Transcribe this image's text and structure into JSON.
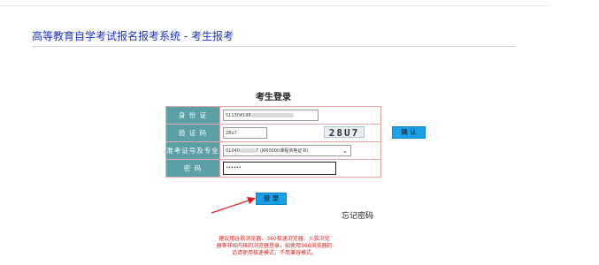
{
  "header": {
    "system_title": "高等教育自学考试报名报考系统 - 考生报考"
  },
  "login": {
    "heading": "考生登录",
    "id_label": "身 份 证",
    "id_value": "511304198",
    "captcha_label": "验 证 码",
    "captcha_input_value": "28u7",
    "captcha_image_text": "28U7",
    "confirm_button": "确 认",
    "major_label": "准考证号及专业",
    "major_select_value": "01040",
    "major_select_suffix": "7 (J660000课程资格证书)",
    "password_label": "密 码",
    "password_value": "••••••",
    "login_button": "登 录",
    "forgot_password": "忘记密码"
  },
  "notice": {
    "lines": [
      "建议用谷歌浏览器、360极速浏览器、火狐浏览",
      "器等非IE内核的浏览器登录，如使用360浏览器的",
      "话请使用极速模式，不用兼容模式。"
    ]
  },
  "colors": {
    "title_blue": "#1a2fd6",
    "label_teal": "#5aa0a5",
    "button_blue": "#1aa0ea",
    "notice_red": "#e02020",
    "table_border": "#e6a8a8",
    "arrow_red": "#e02020"
  },
  "icons": {
    "select_chevron": "chevron-down-icon",
    "annotation_arrow": "red-arrow-icon"
  }
}
